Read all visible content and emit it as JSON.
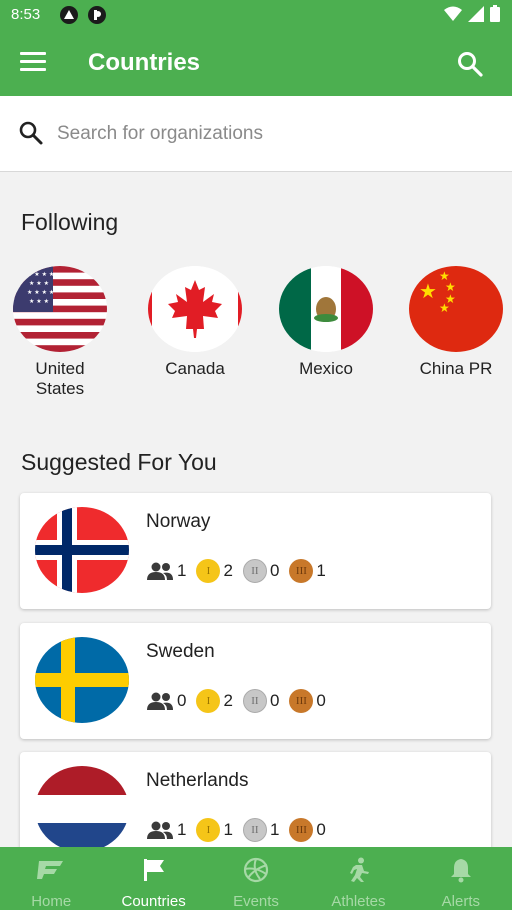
{
  "status": {
    "time": "8:53"
  },
  "appbar": {
    "title": "Countries"
  },
  "search": {
    "placeholder": "Search for organizations"
  },
  "following": {
    "heading": "Following",
    "items": [
      {
        "name": "United States"
      },
      {
        "name": "Canada"
      },
      {
        "name": "Mexico"
      },
      {
        "name": "China PR"
      }
    ]
  },
  "suggested": {
    "heading": "Suggested For You",
    "items": [
      {
        "name": "Norway",
        "athletes": "1",
        "gold": "2",
        "silver": "0",
        "bronze": "1"
      },
      {
        "name": "Sweden",
        "athletes": "0",
        "gold": "2",
        "silver": "0",
        "bronze": "0"
      },
      {
        "name": "Netherlands",
        "athletes": "1",
        "gold": "1",
        "silver": "1",
        "bronze": "0"
      }
    ]
  },
  "medals": {
    "gold_symbol": "I",
    "silver_symbol": "II",
    "bronze_symbol": "III"
  },
  "nav": {
    "items": [
      {
        "label": "Home",
        "icon": "home-logo-icon"
      },
      {
        "label": "Countries",
        "icon": "flag-icon"
      },
      {
        "label": "Events",
        "icon": "volleyball-icon"
      },
      {
        "label": "Athletes",
        "icon": "athlete-icon"
      },
      {
        "label": "Alerts",
        "icon": "bell-icon"
      }
    ],
    "active": "Countries"
  },
  "colors": {
    "primary": "#4caf50",
    "gold": "#f5c518",
    "silver": "#c7c7c7",
    "bronze": "#c8782a"
  }
}
